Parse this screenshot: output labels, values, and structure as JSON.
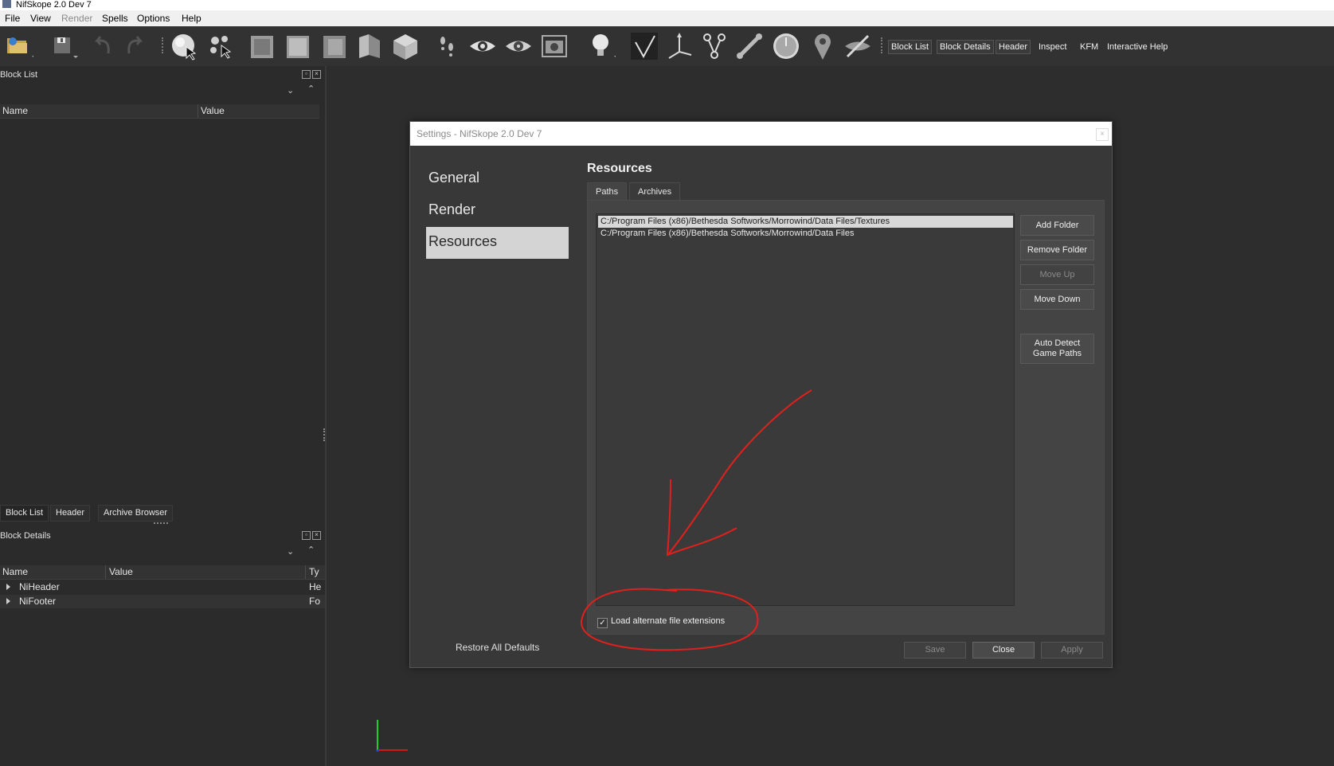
{
  "window": {
    "title": "NifSkope 2.0 Dev 7"
  },
  "menu": [
    "File",
    "View",
    "Render",
    "Spells",
    "Options",
    "Help"
  ],
  "menu_disabled": "Render",
  "toolbar": {
    "icons": [
      "open-file-icon",
      "save-icon",
      "undo-icon",
      "redo-icon",
      "select-object-icon",
      "select-vertex-icon",
      "view-front-icon",
      "view-side-icon",
      "view-top-icon",
      "view-walk-icon",
      "view-user-icon",
      "footprints-icon",
      "eye-icon",
      "eye-alt-icon",
      "screenshot-icon",
      "lightbulb-icon",
      "normals-icon",
      "axes-icon",
      "nodes-icon",
      "bone-icon",
      "clock-icon",
      "marker-icon",
      "hide-icon"
    ],
    "text_buttons": [
      "Block List",
      "Block Details",
      "Header",
      "Inspect",
      "KFM",
      "Interactive Help"
    ]
  },
  "block_list": {
    "title": "Block List",
    "columns": [
      "Name",
      "Value"
    ]
  },
  "bottom_tabs": [
    "Block List",
    "Header",
    "Archive Browser"
  ],
  "block_details": {
    "title": "Block Details",
    "columns": [
      "Name",
      "Value",
      "Ty"
    ],
    "rows": [
      {
        "name": "NiHeader",
        "type": "He"
      },
      {
        "name": "NiFooter",
        "type": "Fo"
      }
    ]
  },
  "settings": {
    "title": "Settings - NifSkope 2.0 Dev 7",
    "close_glyph": "×",
    "nav": [
      "General",
      "Render",
      "Resources"
    ],
    "nav_selected": "Resources",
    "heading": "Resources",
    "tabs": [
      "Paths",
      "Archives"
    ],
    "paths": [
      "C:/Program Files (x86)/Bethesda Softworks/Morrowind/Data Files/Textures",
      "C:/Program Files (x86)/Bethesda Softworks/Morrowind/Data Files"
    ],
    "buttons": {
      "add_folder": "Add Folder",
      "remove_folder": "Remove Folder",
      "move_up": "Move Up",
      "move_down": "Move Down",
      "auto_detect_line1": "Auto Detect",
      "auto_detect_line2": "Game Paths"
    },
    "checkbox": {
      "label": "Load alternate file extensions",
      "checked": true,
      "glyph": "✓"
    },
    "restore_defaults": "Restore All Defaults",
    "footer": {
      "save": "Save",
      "close": "Close",
      "apply": "Apply"
    }
  },
  "colors": {
    "background": "#2d2d2d",
    "dialog": "#383838",
    "selection": "#d8d8d8",
    "annotation": "#e0201c"
  }
}
